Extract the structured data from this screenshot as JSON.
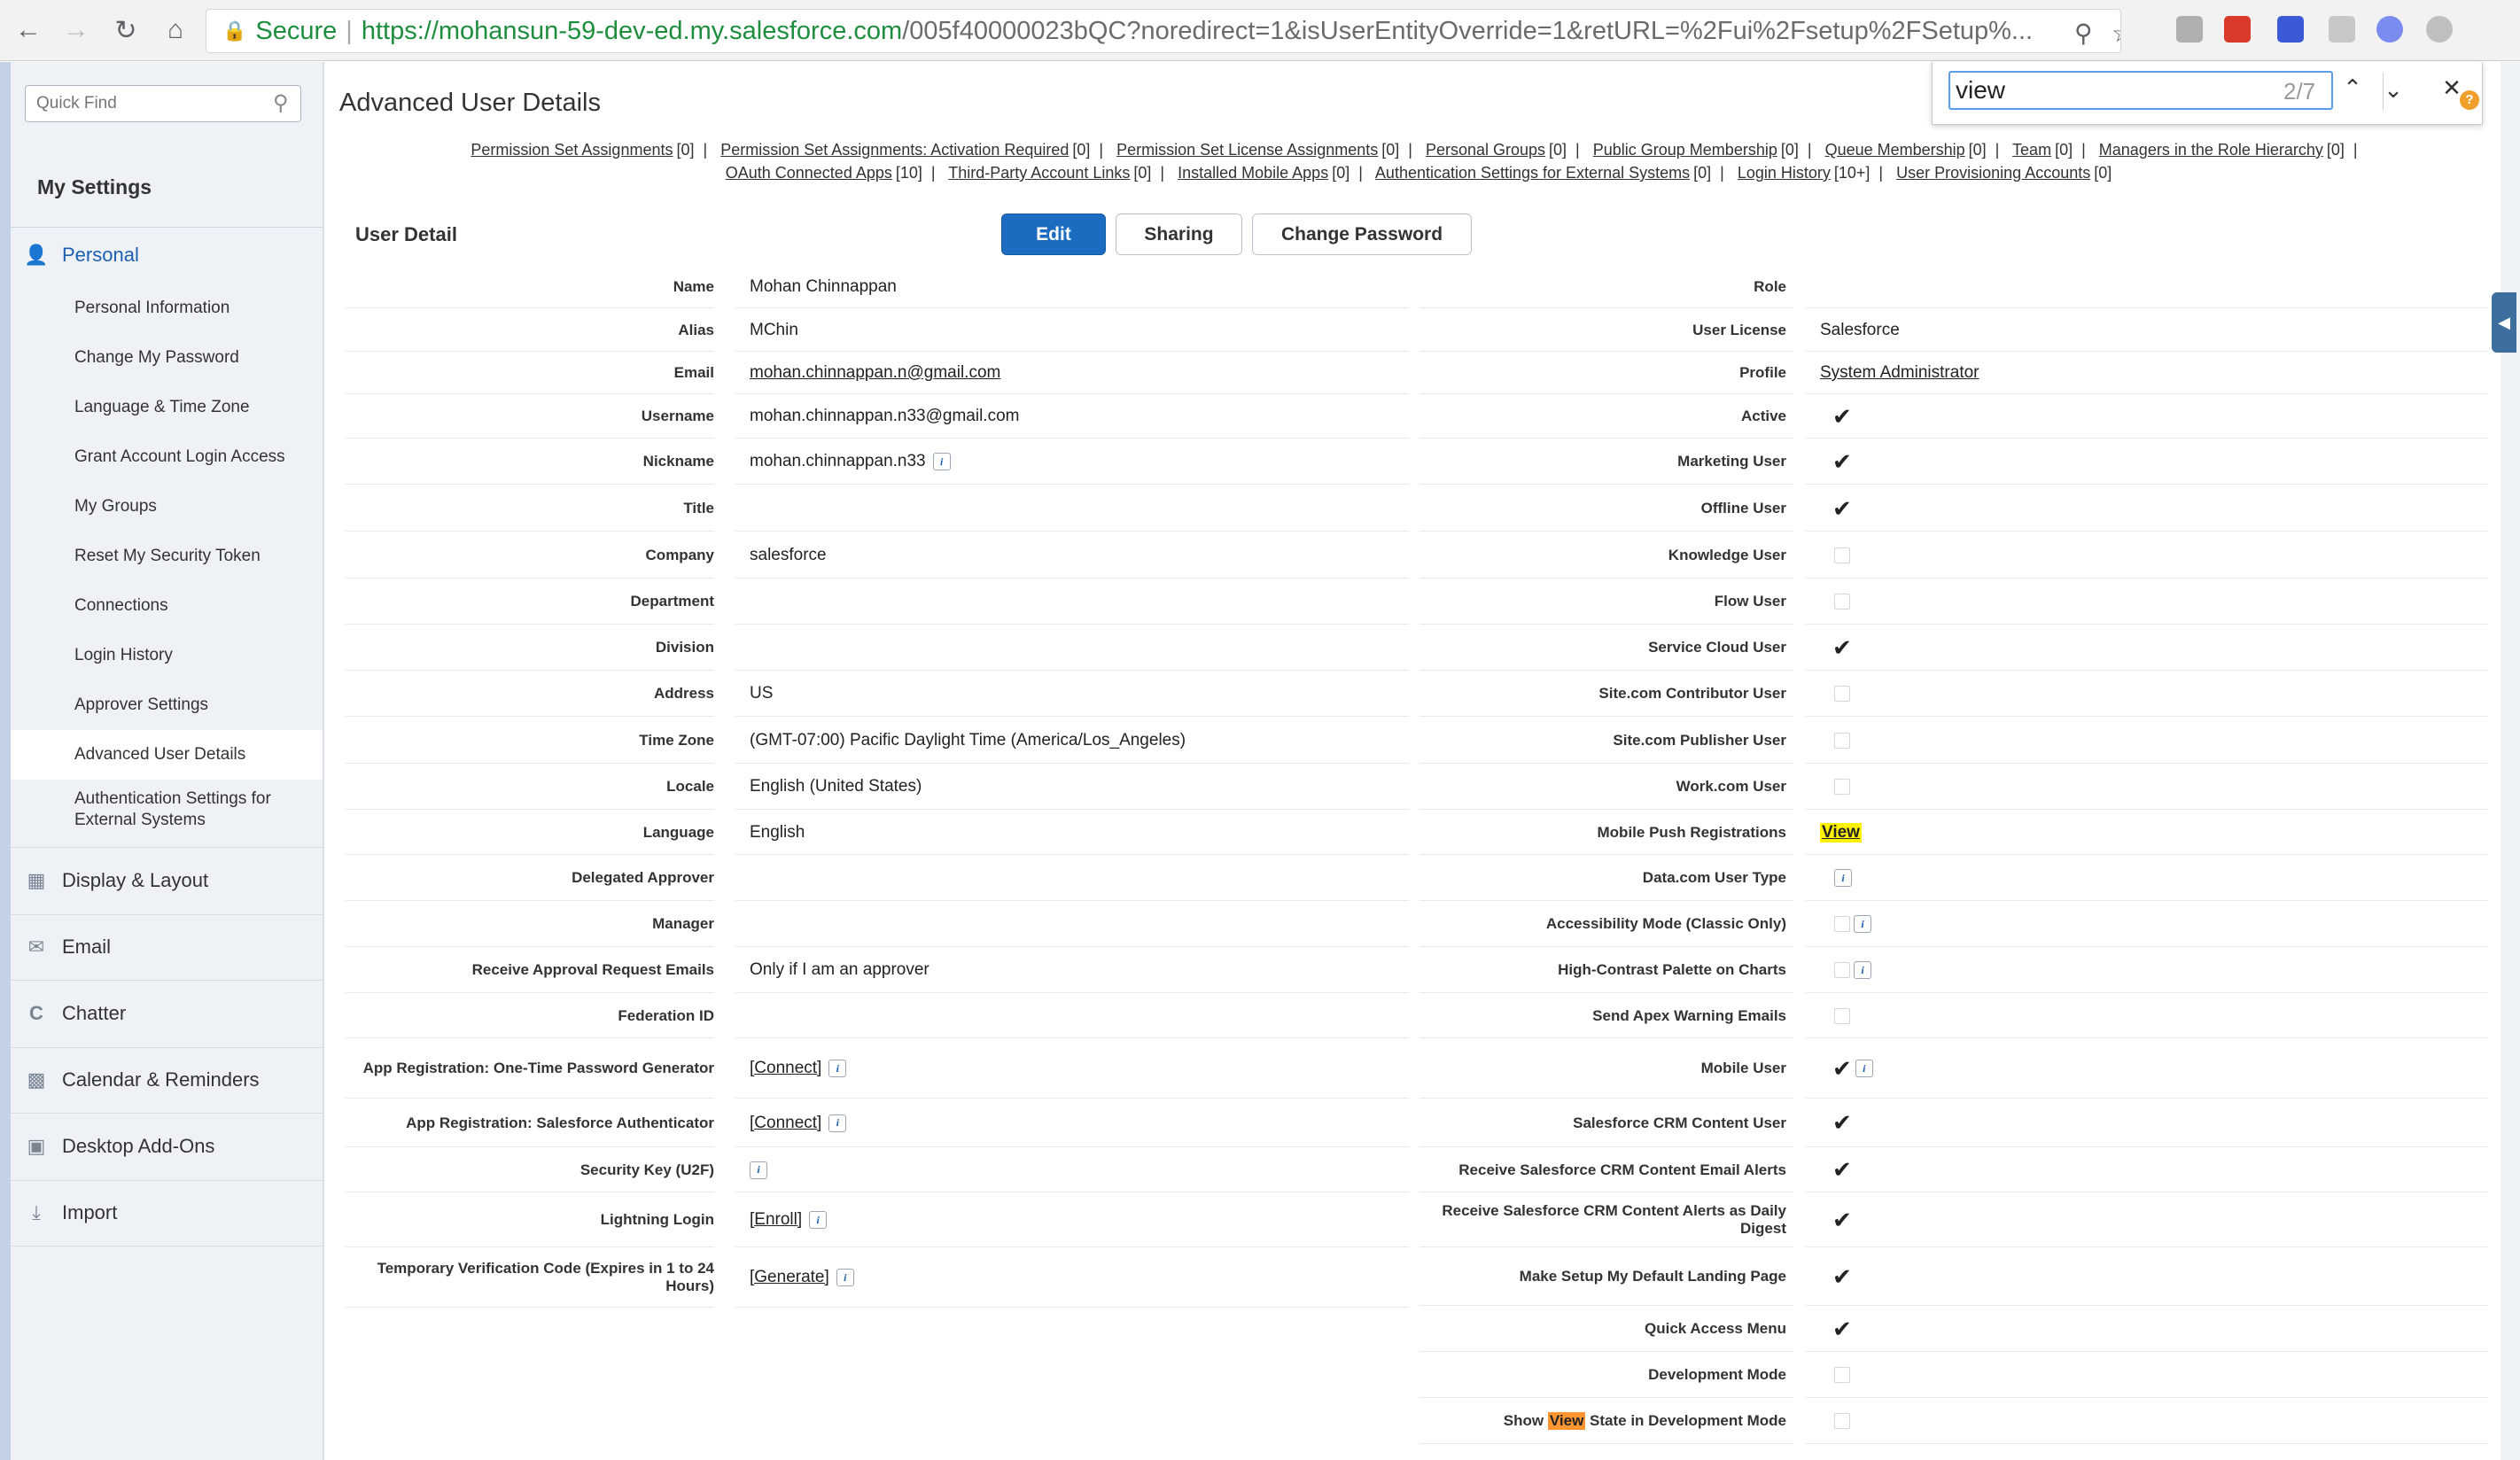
{
  "browser": {
    "secure_label": "Secure",
    "url_host": "https://mohansun-59-dev-ed.my.salesforce.com",
    "url_path": "/005f40000023bQC?noredirect=1&isUserEntityOverride=1&retURL=%2Fui%2Fsetup%2FSetup%..."
  },
  "findbar": {
    "query": "view",
    "count": "2/7"
  },
  "sidebar": {
    "quickfind_placeholder": "Quick Find",
    "title": "My Settings",
    "personal": "Personal",
    "personal_items": [
      "Personal Information",
      "Change My Password",
      "Language & Time Zone",
      "Grant Account Login Access",
      "My Groups",
      "Reset My Security Token",
      "Connections",
      "Login History",
      "Approver Settings",
      "Advanced User Details",
      "Authentication Settings for External Systems"
    ],
    "sections": [
      "Display & Layout",
      "Email",
      "Chatter",
      "Calendar & Reminders",
      "Desktop Add-Ons",
      "Import"
    ]
  },
  "main": {
    "title": "Advanced User Details",
    "related_links": [
      {
        "label": "Permission Set Assignments",
        "count": "[0]"
      },
      {
        "label": "Permission Set Assignments: Activation Required",
        "count": "[0]"
      },
      {
        "label": "Permission Set License Assignments",
        "count": "[0]"
      },
      {
        "label": "Personal Groups",
        "count": "[0]"
      },
      {
        "label": "Public Group Membership",
        "count": "[0]"
      },
      {
        "label": "Queue Membership",
        "count": "[0]"
      },
      {
        "label": "Team",
        "count": "[0]"
      },
      {
        "label": "Managers in the Role Hierarchy",
        "count": "[0]"
      },
      {
        "label": "OAuth Connected Apps",
        "count": "[10]"
      },
      {
        "label": "Third-Party Account Links",
        "count": "[0]"
      },
      {
        "label": "Installed Mobile Apps",
        "count": "[0]"
      },
      {
        "label": "Authentication Settings for External Systems",
        "count": "[0]"
      },
      {
        "label": "Login History",
        "count": "[10+]"
      },
      {
        "label": "User Provisioning Accounts",
        "count": "[0]"
      }
    ],
    "detail_title": "User Detail",
    "buttons": {
      "edit": "Edit",
      "sharing": "Sharing",
      "change_password": "Change Password"
    },
    "left_fields": [
      {
        "label": "Name",
        "value": "Mohan Chinnappan"
      },
      {
        "label": "Alias",
        "value": "MChin"
      },
      {
        "label": "Email",
        "value": "mohan.chinnappan.n@gmail.com",
        "link": true
      },
      {
        "label": "Username",
        "value": "mohan.chinnappan.n33@gmail.com"
      },
      {
        "label": "Nickname",
        "value": "mohan.chinnappan.n33",
        "info": true
      },
      {
        "label": "Title",
        "value": ""
      },
      {
        "label": "Company",
        "value": "salesforce"
      },
      {
        "label": "Department",
        "value": ""
      },
      {
        "label": "Division",
        "value": ""
      },
      {
        "label": "Address",
        "value": "US"
      },
      {
        "label": "Time Zone",
        "value": "(GMT-07:00) Pacific Daylight Time (America/Los_Angeles)"
      },
      {
        "label": "Locale",
        "value": "English (United States)"
      },
      {
        "label": "Language",
        "value": "English"
      },
      {
        "label": "Delegated Approver",
        "value": ""
      },
      {
        "label": "Manager",
        "value": ""
      },
      {
        "label": "Receive Approval Request Emails",
        "value": "Only if I am an approver"
      },
      {
        "label": "Federation ID",
        "value": ""
      },
      {
        "label": "App Registration: One-Time Password Generator",
        "value": "[Connect]",
        "link": true,
        "info": true
      },
      {
        "label": "App Registration: Salesforce Authenticator",
        "value": "[Connect]",
        "link": true,
        "info": true
      },
      {
        "label": "Security Key (U2F)",
        "value": "",
        "info": true
      },
      {
        "label": "Lightning Login",
        "value": "[Enroll]",
        "link": true,
        "info": true
      },
      {
        "label": "Temporary Verification Code (Expires in 1 to 24 Hours)",
        "value": "[Generate]",
        "link": true,
        "info": true
      }
    ],
    "right_fields": [
      {
        "label": "Role",
        "type": "text",
        "value": ""
      },
      {
        "label": "User License",
        "type": "text",
        "value": "Salesforce"
      },
      {
        "label": "Profile",
        "type": "link",
        "value": "System Administrator"
      },
      {
        "label": "Active",
        "type": "check",
        "checked": true
      },
      {
        "label": "Marketing User",
        "type": "check",
        "checked": true
      },
      {
        "label": "Offline User",
        "type": "check",
        "checked": true
      },
      {
        "label": "Knowledge User",
        "type": "check",
        "checked": false
      },
      {
        "label": "Flow User",
        "type": "check",
        "checked": false
      },
      {
        "label": "Service Cloud User",
        "type": "check",
        "checked": true
      },
      {
        "label": "Site.com Contributor User",
        "type": "check",
        "checked": false
      },
      {
        "label": "Site.com Publisher User",
        "type": "check",
        "checked": false
      },
      {
        "label": "Work.com User",
        "type": "check",
        "checked": false
      },
      {
        "label": "Mobile Push Registrations",
        "type": "highlight-link",
        "value": "View"
      },
      {
        "label": "Data.com User Type",
        "type": "info-only"
      },
      {
        "label": "Accessibility Mode (Classic Only)",
        "type": "check",
        "checked": false,
        "info": true
      },
      {
        "label": "High-Contrast Palette on Charts",
        "type": "check",
        "checked": false,
        "info": true
      },
      {
        "label": "Send Apex Warning Emails",
        "type": "check",
        "checked": false
      },
      {
        "label": "Mobile User",
        "type": "check",
        "checked": true,
        "info": true
      },
      {
        "label": "Salesforce CRM Content User",
        "type": "check",
        "checked": true
      },
      {
        "label": "Receive Salesforce CRM Content Email Alerts",
        "type": "check",
        "checked": true
      },
      {
        "label": "Receive Salesforce CRM Content Alerts as Daily Digest",
        "type": "check",
        "checked": true
      },
      {
        "label": "Make Setup My Default Landing Page",
        "type": "check",
        "checked": true
      },
      {
        "label": "Quick Access Menu",
        "type": "check",
        "checked": true
      },
      {
        "label": "Development Mode",
        "type": "check",
        "checked": false
      },
      {
        "label": "Show View State in Development Mode",
        "type": "check",
        "checked": false,
        "label_before": "Show ",
        "label_highlight": "View",
        "label_after": " State in Development Mode"
      }
    ]
  },
  "colors": {
    "accent": "#1b6bc0",
    "find_highlight_current": "#fff200",
    "find_highlight_other": "#ff9632",
    "secure_green": "#1e8e3e"
  }
}
